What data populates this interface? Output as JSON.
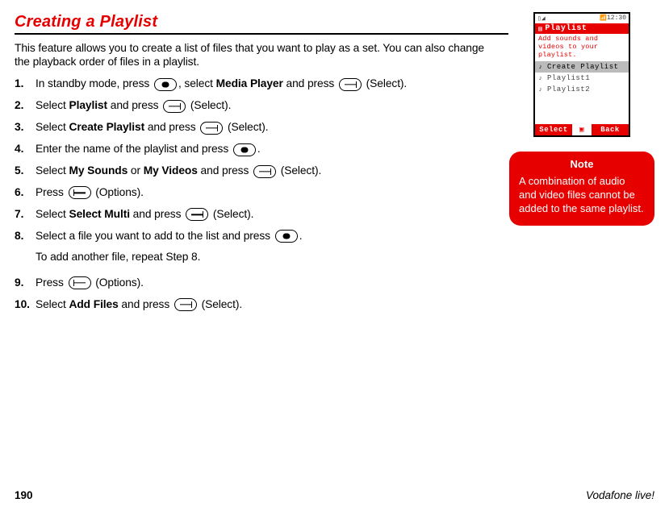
{
  "heading": "Creating a Playlist",
  "intro": "This feature allows you to create a list of files that you want to play as a set. You can also change the playback order of files in a playlist.",
  "steps": [
    {
      "num": "1.",
      "parts": [
        "In standby mode, press ",
        "{dot}",
        ", select ",
        "{b:Media Player}",
        " and press ",
        "{ldash}",
        " (Select)."
      ]
    },
    {
      "num": "2.",
      "parts": [
        "Select ",
        "{b:Playlist}",
        " and press ",
        "{ldash}",
        " (Select)."
      ]
    },
    {
      "num": "3.",
      "parts": [
        "Select ",
        "{b:Create Playlist}",
        " and press ",
        "{ldash}",
        " (Select)."
      ]
    },
    {
      "num": "4.",
      "parts": [
        "Enter the name of the playlist and press ",
        "{dot}",
        "."
      ]
    },
    {
      "num": "5.",
      "parts": [
        "Select ",
        "{b:My Sounds}",
        " or ",
        "{b:My Videos}",
        " and press ",
        "{ldash}",
        " (Select)."
      ]
    },
    {
      "num": "6.",
      "parts": [
        "Press ",
        "{rdash}",
        " (Options)."
      ]
    },
    {
      "num": "7.",
      "parts": [
        "Select ",
        "{b:Select Multi}",
        " and press ",
        "{ldash}",
        " (Select)."
      ]
    },
    {
      "num": "8.",
      "parts": [
        "Select a file you want to add to the list and press ",
        "{dot}",
        "."
      ],
      "sub": "To add another file, repeat Step 8."
    },
    {
      "num": "9.",
      "parts": [
        "Press ",
        "{rdash}",
        " (Options)."
      ]
    },
    {
      "num": "10.",
      "parts": [
        "Select ",
        "{b:Add Files}",
        " and press ",
        "{ldash}",
        " (Select)."
      ]
    }
  ],
  "phone": {
    "time": "12:30",
    "title": "Playlist",
    "hint": "Add sounds and videos to your playlist.",
    "items": [
      {
        "label": "Create Playlist",
        "sel": true
      },
      {
        "label": "Playlist1",
        "sel": false
      },
      {
        "label": "Playlist2",
        "sel": false
      }
    ],
    "sk_left": "Select",
    "sk_right": "Back"
  },
  "note": {
    "title": "Note",
    "body": "A combination of audio and video files cannot be added to the same playlist."
  },
  "footer": {
    "page": "190",
    "brand": "Vodafone live!"
  }
}
